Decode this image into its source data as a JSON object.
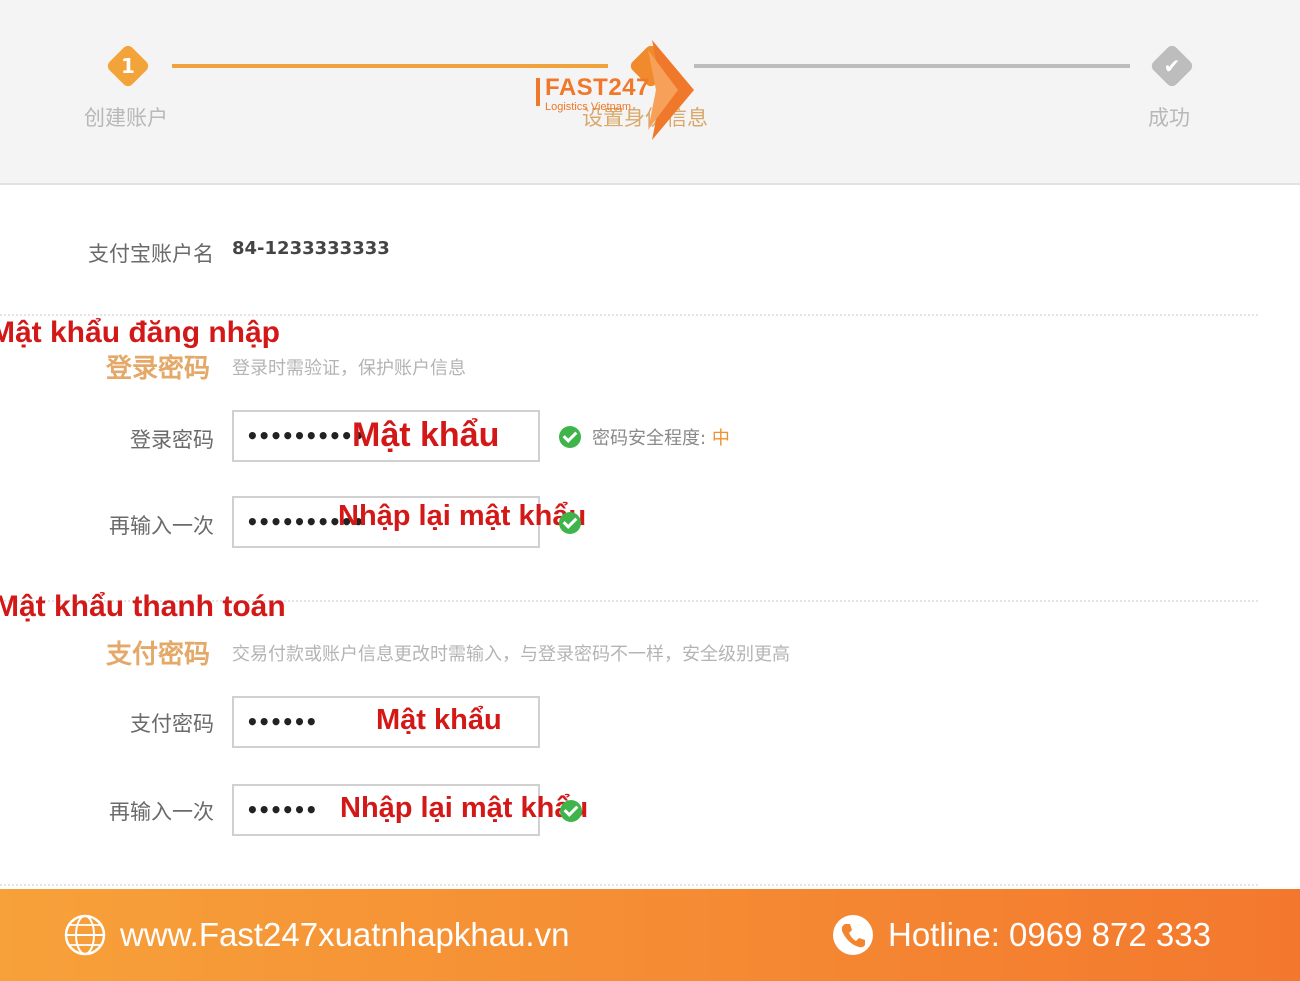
{
  "steps": [
    {
      "number": "1",
      "label": "创建账户"
    },
    {
      "number": "",
      "label": "设置身份信息"
    },
    {
      "number": "",
      "label": "成功"
    }
  ],
  "brand": {
    "name": "FAST247",
    "tagline": "Logistics Vietnam"
  },
  "account": {
    "label": "支付宝账户名",
    "value": "84-1233333333"
  },
  "login_section": {
    "annotation": "Mật khẩu đăng nhập",
    "title": "登录密码",
    "description": "登录时需验证，保护账户信息",
    "password": {
      "label": "登录密码",
      "value": "••••••••••",
      "hint": "Mật khẩu"
    },
    "confirm": {
      "label": "再输入一次",
      "value": "••••••••••",
      "hint": "Nhập lại mật khẩu"
    },
    "strength_label": "密码安全程度:",
    "strength_value": "中"
  },
  "payment_section": {
    "annotation": "Mật khẩu thanh toán",
    "title": "支付密码",
    "description": "交易付款或账户信息更改时需输入，与登录密码不一样，安全级别更高",
    "password": {
      "label": "支付密码",
      "value": "••••••",
      "hint": "Mật khẩu"
    },
    "confirm": {
      "label": "再输入一次",
      "value": "••••••",
      "hint": "Nhập lại mật khẩu"
    }
  },
  "footer": {
    "website": "www.Fast247xuatnhapkhau.vn",
    "hotline": "Hotline: 0969 872 333"
  },
  "colors": {
    "accent": "#f0782b",
    "annotation": "#d31818",
    "success": "#3fb44b",
    "footer_start": "#f7a13a",
    "footer_end": "#f3782e"
  },
  "icons": [
    "check-icon",
    "globe-icon",
    "phone-icon",
    "brand-arrow-icon"
  ]
}
